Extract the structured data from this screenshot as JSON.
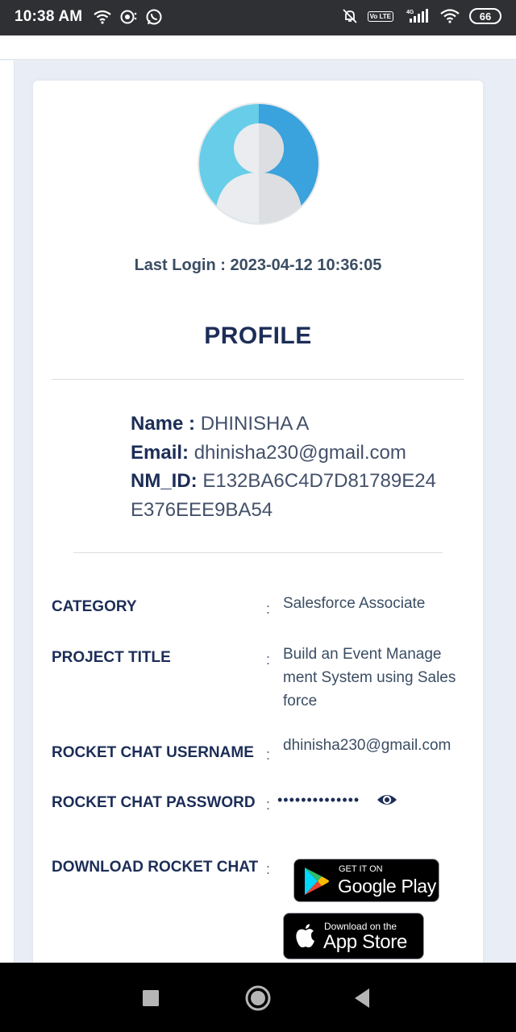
{
  "status_bar": {
    "time": "10:38 AM",
    "network": "4G",
    "volte": "Vo LTE",
    "battery": "66",
    "left_icons": [
      "wifi-icon",
      "chat-bubble-icon",
      "whatsapp-icon"
    ],
    "right_icons": [
      "muted-bell-icon",
      "volte-icon",
      "signal-icon",
      "wifi-icon",
      "battery-icon"
    ]
  },
  "profile": {
    "last_login_label": "Last Login :",
    "last_login_value": "2023-04-12 10:36:05",
    "title": "PROFILE",
    "name_label": "Name :",
    "name_value": "DHINISHA A",
    "email_label": "Email:",
    "email_value": "dhinisha230@gmail.com",
    "nmid_label": "NM_ID:",
    "nmid_value": "E132BA6C4D7D81789E24 E376EEE9BA54"
  },
  "details": {
    "separator": ":",
    "rows": [
      {
        "label": "CATEGORY",
        "value": "Salesforce Associate"
      },
      {
        "label": "PROJECT TITLE",
        "value": "Build an Event Manage ment System using Sales force"
      },
      {
        "label": "ROCKET CHAT USERNAME",
        "value": "dhinisha230@gmail.com"
      },
      {
        "label": "ROCKET CHAT PASSWORD",
        "value": "••••••••••••••"
      },
      {
        "label": "DOWNLOAD ROCKET CHAT",
        "value": ""
      }
    ]
  },
  "badges": {
    "google_play_small": "GET IT ON",
    "google_play_big": "Google Play",
    "app_store_small": "Download on the",
    "app_store_big": "App Store"
  },
  "nav_bar": {
    "buttons": [
      "recents-button",
      "home-button",
      "back-button"
    ]
  }
}
